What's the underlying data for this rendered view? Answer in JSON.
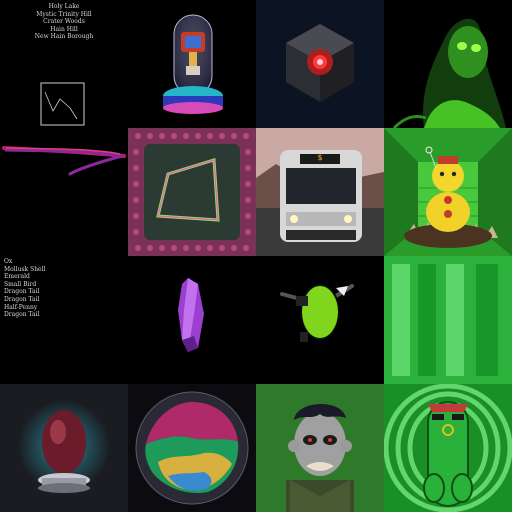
{
  "gallery": {
    "place_names": [
      "Holy Lake",
      "Mystic Trinity Hill",
      "Crater Woods",
      "Hain Hill",
      "New Hain Borough"
    ],
    "trait_names": [
      "Ox",
      "Mollusk Shell",
      "Emerald",
      "Small Bird",
      "Dragon Tail",
      "Dragon Tail",
      "Half-Penny",
      "Dragon Tail"
    ],
    "bus_sign": "$",
    "colors": {
      "background": "#000000",
      "text": "#d8d8d8",
      "accent_green": "#2fd42f",
      "accent_purple": "#a24cd9"
    },
    "tiles": [
      {
        "icon": "map-icon"
      },
      {
        "icon": "robot-in-glass-dome"
      },
      {
        "icon": "glowing-cube"
      },
      {
        "icon": "green-particle-face"
      },
      {
        "icon": "neon-brush-stroke"
      },
      {
        "icon": "neon-frame-on-tiles"
      },
      {
        "icon": "city-bus"
      },
      {
        "icon": "golden-idol-on-stairs"
      },
      {
        "icon": "trait-list"
      },
      {
        "icon": "purple-crystal"
      },
      {
        "icon": "green-egg-with-arms"
      },
      {
        "icon": "green-stripes"
      },
      {
        "icon": "dragon-egg-on-pedestal"
      },
      {
        "icon": "fuzzy-planet-sphere"
      },
      {
        "icon": "ape-portrait"
      },
      {
        "icon": "green-pickle-character"
      }
    ]
  }
}
